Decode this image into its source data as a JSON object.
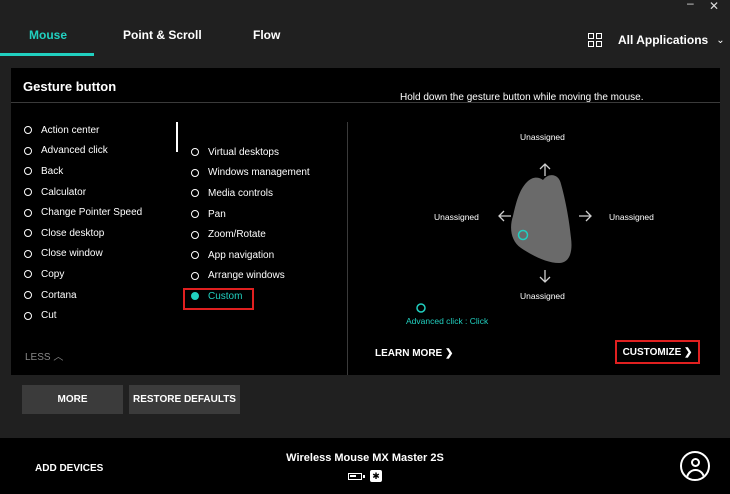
{
  "window": {
    "minimize_glyph": "–",
    "close_glyph": "✕"
  },
  "tabs": [
    {
      "label": "Mouse",
      "active": true
    },
    {
      "label": "Point & Scroll",
      "active": false
    },
    {
      "label": "Flow",
      "active": false
    }
  ],
  "app_selector": {
    "label": "All Applications",
    "icon": "grid-icon",
    "chevron": "⌄"
  },
  "panel": {
    "title": "Gesture button",
    "hint": "Hold down the gesture button while moving the mouse.",
    "left_actions": [
      "Action center",
      "Advanced click",
      "Back",
      "Calculator",
      "Change Pointer Speed",
      "Close desktop",
      "Close window",
      "Copy",
      "Cortana",
      "Cut"
    ],
    "mid_actions": [
      "Virtual desktops",
      "Windows management",
      "Media controls",
      "Pan",
      "Zoom/Rotate",
      "App navigation",
      "Arrange windows",
      "Custom"
    ],
    "selected_action": "Custom",
    "less_label": "LESS ︿",
    "gesture": {
      "up": "Unassigned",
      "left": "Unassigned",
      "right": "Unassigned",
      "down": "Unassigned",
      "click": "Advanced click : Click"
    },
    "learn_more": "LEARN MORE ❯",
    "customize": "CUSTOMIZE ❯"
  },
  "buttons": {
    "more": "MORE",
    "restore": "RESTORE DEFAULTS"
  },
  "footer": {
    "add_devices": "ADD DEVICES",
    "device_name": "Wireless Mouse MX Master 2S",
    "bluetooth_glyph": "✱"
  },
  "colors": {
    "accent": "#21d0c0",
    "highlight": "#e02020",
    "background": "#202020",
    "panel": "#000000"
  }
}
